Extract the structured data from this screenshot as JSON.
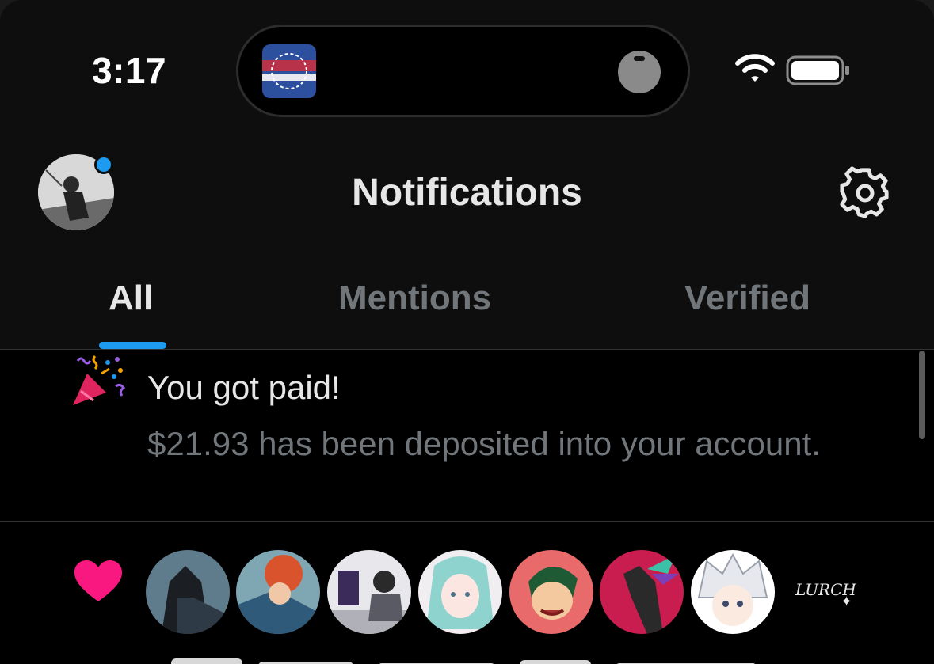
{
  "status_bar": {
    "time": "3:17"
  },
  "header": {
    "title": "Notifications"
  },
  "tabs": [
    {
      "label": "All",
      "active": true
    },
    {
      "label": "Mentions",
      "active": false
    },
    {
      "label": "Verified",
      "active": false
    }
  ],
  "notifications": [
    {
      "icon": "party-popper-icon",
      "title": "You got paid!",
      "body": "$21.93 has been deposited into your account."
    },
    {
      "icon": "heart-icon",
      "avatar_count": 7,
      "trailing_label": "LURCH"
    }
  ],
  "colors": {
    "accent": "#1d9bf0",
    "heart": "#f91880",
    "text_primary": "#e7e7e7",
    "text_secondary": "#71767b",
    "background": "#000000"
  }
}
